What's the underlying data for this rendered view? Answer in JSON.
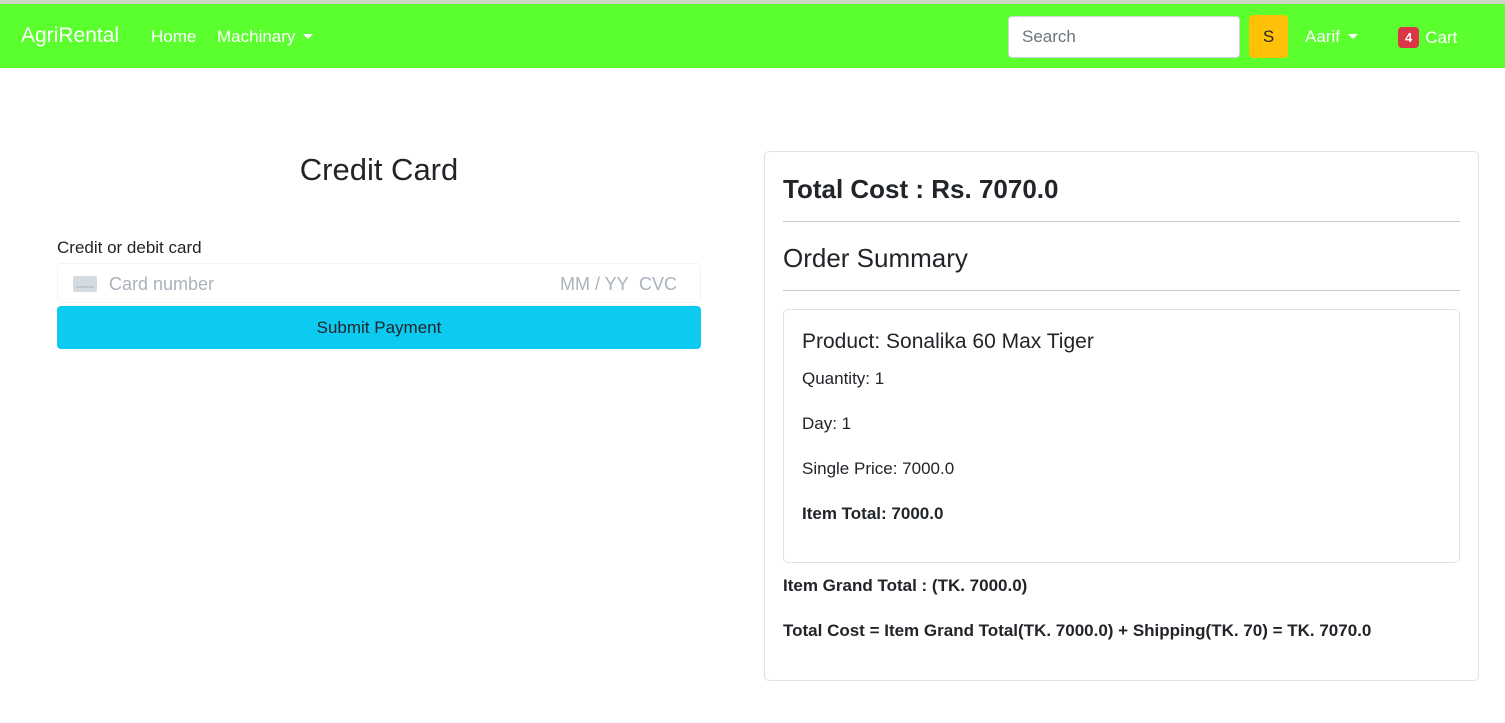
{
  "navbar": {
    "brand": "AgriRental",
    "home_label": "Home",
    "machinary_label": "Machinary",
    "search_placeholder": "Search",
    "search_button_label": "S",
    "user_label": "Aarif",
    "cart_count": "4",
    "cart_label": "Cart",
    "background_color": "#5cff2e"
  },
  "payment": {
    "title": "Credit Card",
    "field_label": "Credit or debit card",
    "card_number_placeholder": "Card number",
    "expiry_placeholder": "MM / YY",
    "cvc_placeholder": "CVC",
    "submit_label": "Submit Payment",
    "submit_color": "#0dcaf0"
  },
  "summary": {
    "total_cost": "Total Cost : Rs. 7070.0",
    "order_summary_title": "Order Summary",
    "product": {
      "title": "Product: Sonalika 60 Max Tiger",
      "quantity": "Quantity: 1",
      "day": "Day: 1",
      "single_price": "Single Price: 7000.0",
      "item_total": "Item Total: 7000.0"
    },
    "item_grand_total": "Item Grand Total : (TK. 7000.0)",
    "cost_formula": "Total Cost = Item Grand Total(TK. 7000.0) + Shipping(TK. 70) = TK. 7070.0"
  }
}
